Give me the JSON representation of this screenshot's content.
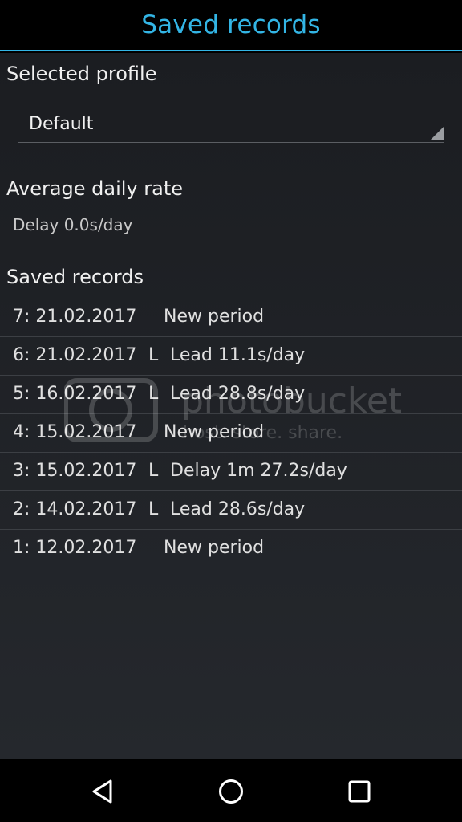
{
  "action_bar": {
    "title": "Saved records",
    "accent_color": "#33b5e5"
  },
  "profile": {
    "heading": "Selected profile",
    "selected_value": "Default"
  },
  "rate": {
    "heading": "Average daily rate",
    "value": "Delay 0.0s/day"
  },
  "records": {
    "heading": "Saved records",
    "items": [
      {
        "date": "7: 21.02.2017",
        "flag": "",
        "description": "New period"
      },
      {
        "date": "6: 21.02.2017",
        "flag": "L",
        "description": "Lead 11.1s/day"
      },
      {
        "date": "5: 16.02.2017",
        "flag": "L",
        "description": "Lead 28.8s/day"
      },
      {
        "date": "4: 15.02.2017",
        "flag": "",
        "description": "New period"
      },
      {
        "date": "3: 15.02.2017",
        "flag": "L",
        "description": "Delay 1m 27.2s/day"
      },
      {
        "date": "2: 14.02.2017",
        "flag": "L",
        "description": "Lead 28.6s/day"
      },
      {
        "date": "1: 12.02.2017",
        "flag": "",
        "description": "New period"
      }
    ]
  },
  "watermark": {
    "brand": "photobucket",
    "tagline": "host. store. share."
  },
  "nav": {
    "icons": [
      "back-icon",
      "home-icon",
      "recents-icon"
    ]
  }
}
